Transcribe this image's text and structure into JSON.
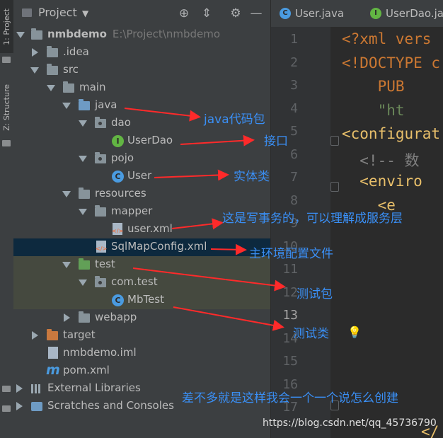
{
  "tool_windows": {
    "project_tab": "1: Project",
    "structure_tab": "Z: Structure"
  },
  "panel": {
    "title": "Project",
    "tree": [
      {
        "name": "nmbdemo",
        "path": "E:\\Project\\nmbdemo"
      },
      {
        "name": ".idea"
      },
      {
        "name": "src"
      },
      {
        "name": "main"
      },
      {
        "name": "java"
      },
      {
        "name": "dao"
      },
      {
        "name": "UserDao"
      },
      {
        "name": "pojo"
      },
      {
        "name": "User"
      },
      {
        "name": "resources"
      },
      {
        "name": "mapper"
      },
      {
        "name": "user.xml"
      },
      {
        "name": "SqlMapConfig.xml"
      },
      {
        "name": "test"
      },
      {
        "name": "com.test"
      },
      {
        "name": "MbTest"
      },
      {
        "name": "webapp"
      },
      {
        "name": "target"
      },
      {
        "name": "nmbdemo.iml"
      },
      {
        "name": "pom.xml"
      },
      {
        "name": "External Libraries"
      },
      {
        "name": "Scratches and Consoles"
      }
    ]
  },
  "editor": {
    "tabs": [
      {
        "label": "User.java"
      },
      {
        "label": "UserDao.jav"
      }
    ],
    "line_numbers": [
      "1",
      "2",
      "3",
      "4",
      "5",
      "6",
      "7",
      "8",
      "9",
      "10",
      "11",
      "12",
      "13",
      "14",
      "15",
      "16",
      "17"
    ],
    "code_lines": [
      {
        "text": "<?xml vers",
        "color": "#cc7832"
      },
      {
        "text": "<!DOCTYPE c",
        "color": "#cc7832"
      },
      {
        "text": "    PUB",
        "color": "#cc7832"
      },
      {
        "text": "    \"ht",
        "color": "#6a8759"
      },
      {
        "text": "<configurat",
        "color": "#e8bf6a"
      },
      {
        "text": "  <!-- 数",
        "color": "#808080"
      },
      {
        "text": "  <enviro",
        "color": "#e8bf6a"
      },
      {
        "text": "    <e",
        "color": "#e8bf6a"
      }
    ],
    "last_line_fragment": "</"
  },
  "annotations": {
    "java": "java代码包",
    "interface": "接口",
    "entity": "实体类",
    "service": "这是写事务的，可以理解成服务层",
    "config": "主环境配置文件",
    "test_pkg": "测试包",
    "test_class": "测试类",
    "footer": "差不多就是这样我会一个一个说怎么创建"
  },
  "watermark": "https://blog.csdn.net/qq_45736790",
  "colors": {
    "annotation": "#3a8ff5",
    "arrow": "#ff2a2a",
    "selection": "#0d293e"
  }
}
